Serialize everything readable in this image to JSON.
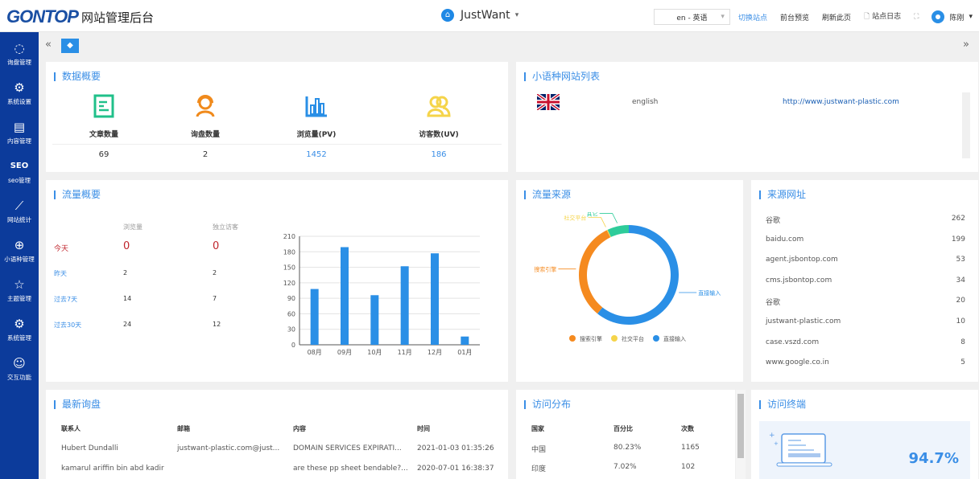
{
  "header": {
    "logo": "GONTOP",
    "title": "网站管理后台",
    "site": "JustWant",
    "language": "en - 英语",
    "links": [
      "切换站点",
      "前台预览",
      "刷新此页",
      "站点日志"
    ],
    "user": "陈刚"
  },
  "sidebar": {
    "items": [
      {
        "label": "询盘管理",
        "icon": "chat-icon"
      },
      {
        "label": "系统设置",
        "icon": "gear-icon"
      },
      {
        "label": "内容管理",
        "icon": "document-icon"
      },
      {
        "label": "seo管理",
        "icon": "seo-icon"
      },
      {
        "label": "网站统计",
        "icon": "line-chart-icon"
      },
      {
        "label": "小语种管理",
        "icon": "globe-icon"
      },
      {
        "label": "主题管理",
        "icon": "theme-icon"
      },
      {
        "label": "系统管理",
        "icon": "gears-icon"
      },
      {
        "label": "交互功能",
        "icon": "users-icon"
      }
    ]
  },
  "overview": {
    "title": "数据概要",
    "items": [
      {
        "label": "文章数量",
        "value": "69",
        "color": "#20c08a"
      },
      {
        "label": "询盘数量",
        "value": "2",
        "color": "#f08a1c"
      },
      {
        "label": "浏览量(PV)",
        "value": "1452",
        "color": "#2a8fe6"
      },
      {
        "label": "访客数(UV)",
        "value": "186",
        "color": "#f5d44a"
      }
    ]
  },
  "languages": {
    "title": "小语种网站列表",
    "rows": [
      {
        "name": "english",
        "url": "http://www.justwant-plastic.com"
      }
    ]
  },
  "traffic": {
    "title": "流量概要",
    "headers": [
      "浏览量",
      "独立访客"
    ],
    "rows": [
      {
        "label": "今天",
        "pv": "0",
        "uv": "0"
      },
      {
        "label": "昨天",
        "pv": "2",
        "uv": "2"
      },
      {
        "label": "过去7天",
        "pv": "14",
        "uv": "7"
      },
      {
        "label": "过去30天",
        "pv": "24",
        "uv": "12"
      }
    ]
  },
  "chart_data": [
    {
      "type": "bar",
      "categories": [
        "08月",
        "09月",
        "10月",
        "11月",
        "12月",
        "01月"
      ],
      "values": [
        108,
        189,
        96,
        152,
        177,
        16
      ],
      "ylim": [
        0,
        210
      ],
      "yticks": [
        0,
        30,
        60,
        90,
        120,
        150,
        180,
        210
      ],
      "grid": true,
      "color": "#2a8fe6"
    },
    {
      "type": "pie",
      "title": "流量来源",
      "donut": true,
      "slices": [
        {
          "name": "直接输入",
          "value": 61,
          "color": "#2a8fe6"
        },
        {
          "name": "搜索引擎",
          "value": 32,
          "color": "#f58a1f"
        },
        {
          "name": "社交平台",
          "value": 0.3,
          "color": "#f5d44a"
        },
        {
          "name": "其它",
          "value": 7,
          "color": "#2ecc9a"
        }
      ],
      "legend": [
        "搜索引擎",
        "社交平台",
        "直接输入"
      ],
      "legend_position": "bottom"
    }
  ],
  "referrers": {
    "title": "来源网址",
    "rows": [
      {
        "site": "谷歌",
        "count": "262"
      },
      {
        "site": "baidu.com",
        "count": "199"
      },
      {
        "site": "agent.jsbontop.com",
        "count": "53"
      },
      {
        "site": "cms.jsbontop.com",
        "count": "34"
      },
      {
        "site": "谷歌",
        "count": "20"
      },
      {
        "site": "justwant-plastic.com",
        "count": "10"
      },
      {
        "site": "case.vszd.com",
        "count": "8"
      },
      {
        "site": "www.google.co.in",
        "count": "5"
      }
    ]
  },
  "inquiries": {
    "title": "最新询盘",
    "headers": [
      "联系人",
      "邮箱",
      "内容",
      "时间"
    ],
    "rows": [
      [
        "Hubert Dundalli",
        "justwant-plastic.com@just...",
        "DOMAIN SERVICES EXPIRATI...",
        "2021-01-03 01:35:26"
      ],
      [
        "kamarul ariffin bin abd kadir",
        "",
        "are these pp sheet bendable?...",
        "2020-07-01 16:38:37"
      ]
    ]
  },
  "visits": {
    "title": "访问分布",
    "headers": [
      "国家",
      "百分比",
      "次数"
    ],
    "rows": [
      [
        "中国",
        "80.23%",
        "1165"
      ],
      [
        "印度",
        "7.02%",
        "102"
      ]
    ]
  },
  "terminal": {
    "title": "访问终端",
    "percent": "94.7%"
  }
}
